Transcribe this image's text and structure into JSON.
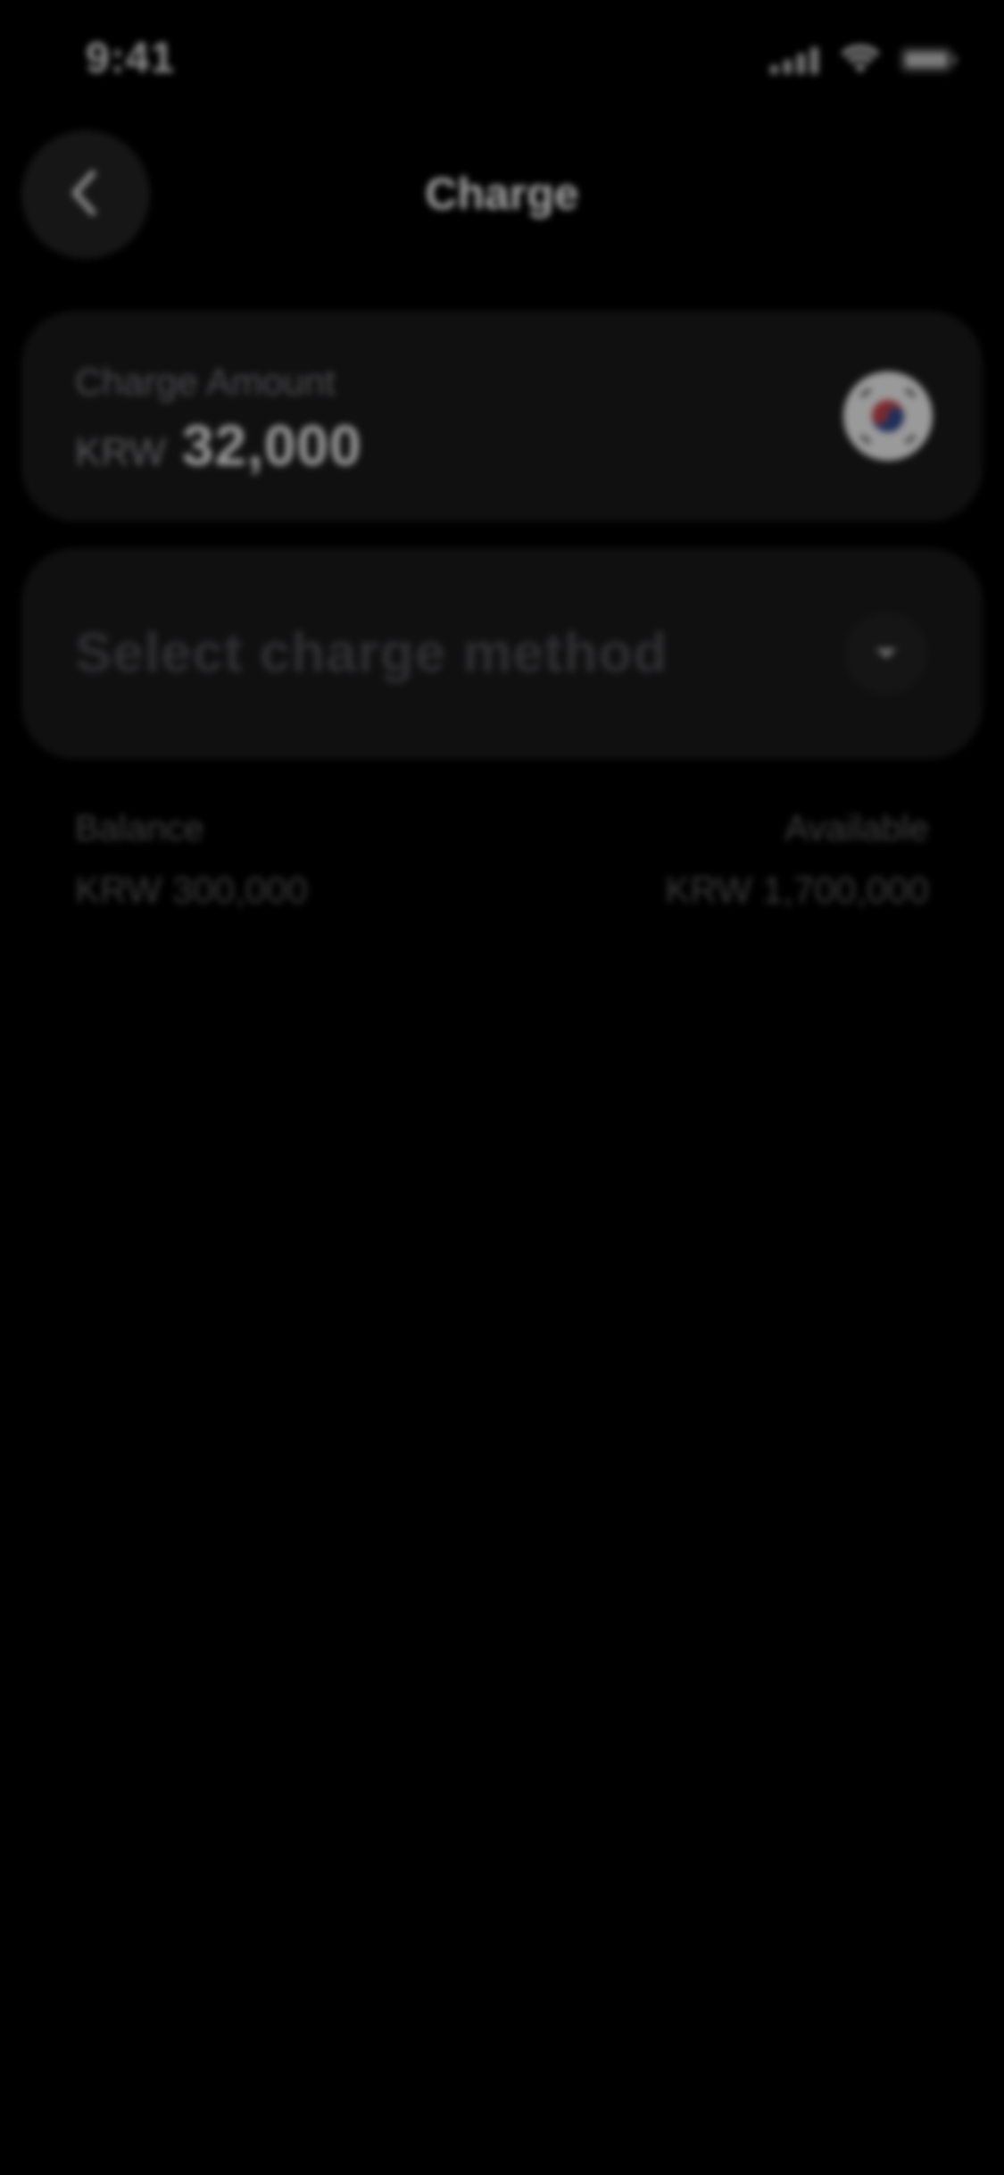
{
  "status_bar": {
    "time": "9:41",
    "icons": [
      "cellular-signal-icon",
      "wifi-icon",
      "battery-icon"
    ]
  },
  "header": {
    "title": "Charge",
    "back_icon": "chevron-left-icon"
  },
  "charge_amount": {
    "label": "Charge Amount",
    "currency": "KRW",
    "value": "32,000",
    "flag_icon": "south-korea-flag-icon"
  },
  "charge_method": {
    "placeholder": "Select charge method",
    "dropdown_icon": "caret-down-icon"
  },
  "balance": {
    "label": "Balance",
    "value": "KRW 300,000"
  },
  "available": {
    "label": "Available",
    "value": "KRW 1,700,000"
  },
  "colors": {
    "background": "#000000",
    "card": "#101011"
  }
}
